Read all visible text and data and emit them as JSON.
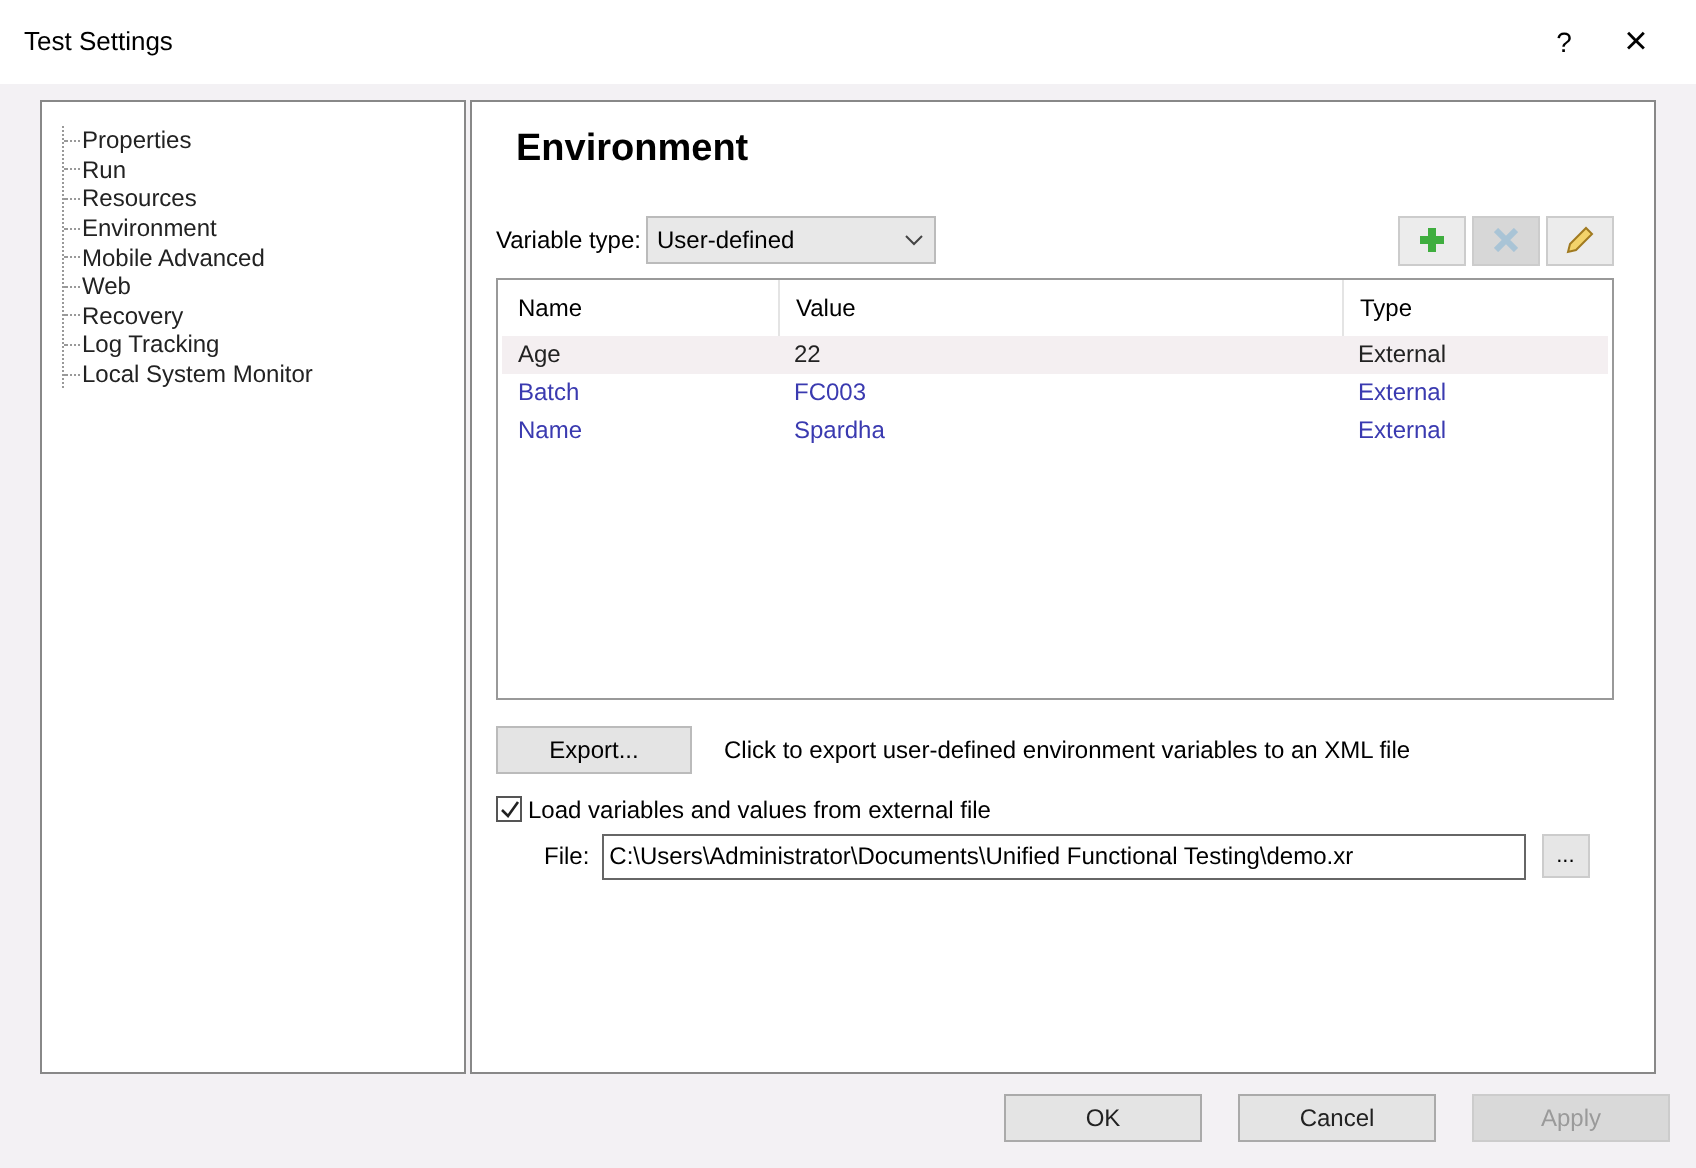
{
  "window": {
    "title": "Test Settings",
    "help": "?",
    "close": "×"
  },
  "tree": {
    "items": [
      "Properties",
      "Run",
      "Resources",
      "Environment",
      "Mobile Advanced",
      "Web",
      "Recovery",
      "Log Tracking",
      "Local System Monitor"
    ]
  },
  "panel": {
    "heading": "Environment",
    "variable_type": {
      "label": "Variable type:",
      "value": "User-defined"
    },
    "toolbar": [
      {
        "kind": "add",
        "disabled": false
      },
      {
        "kind": "delete",
        "disabled": true
      },
      {
        "kind": "edit",
        "disabled": false
      }
    ],
    "table": {
      "columns": [
        "Name",
        "Value",
        "Type"
      ],
      "rows": [
        {
          "cells": [
            "Age",
            "22",
            "External"
          ],
          "selected": true
        },
        {
          "cells": [
            "Batch",
            "FC003",
            "External"
          ],
          "selected": false
        },
        {
          "cells": [
            "Name",
            "Spardha",
            "External"
          ],
          "selected": false
        }
      ]
    },
    "export_button": "Export...",
    "export_hint": "Click to export user-defined environment variables to an XML file",
    "load_checkbox": {
      "label": "Load variables and values from external file",
      "checked": true
    },
    "file": {
      "label": "File:",
      "value": "C:\\Users\\Administrator\\Documents\\Unified Functional Testing\\demo.xr",
      "browse": "..."
    }
  },
  "buttons": [
    {
      "label": "OK",
      "disabled": false
    },
    {
      "label": "Cancel",
      "disabled": false
    },
    {
      "label": "Apply",
      "disabled": true
    }
  ]
}
